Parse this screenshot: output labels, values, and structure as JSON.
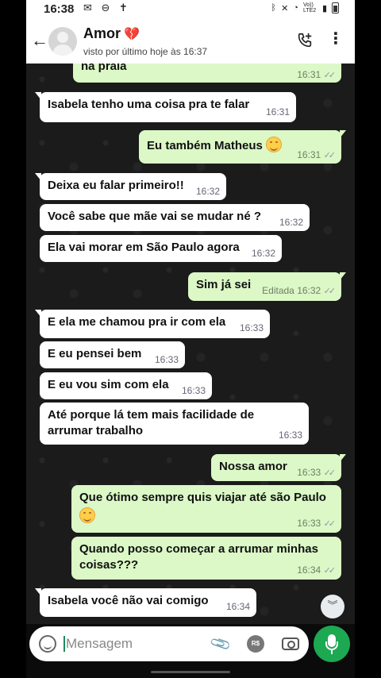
{
  "status_bar": {
    "time": "16:38",
    "left_icons": "✉ ⊖ ✝",
    "network_label": "Vo)) LTE2"
  },
  "header": {
    "contact_name": "Amor",
    "heart_emoji": "💔",
    "last_seen": "visto por último hoje às 16:37",
    "icons": [
      "back-arrow-icon",
      "avatar",
      "add-call-icon",
      "kebab-menu-icon"
    ]
  },
  "messages": [
    {
      "dir": "out",
      "text": "na praia",
      "time": "16:31",
      "ticks": "✓✓"
    },
    {
      "dir": "in",
      "text": "Isabela tenho uma coisa pra te falar",
      "time": "16:31"
    },
    {
      "dir": "out",
      "text": "Eu também Matheus",
      "time": "16:31",
      "ticks": "✓✓",
      "emoji": "smiling-face"
    },
    {
      "dir": "in",
      "text": "Deixa eu falar primeiro!!",
      "time": "16:32"
    },
    {
      "dir": "in",
      "text": "Você sabe que mãe vai se mudar né ?",
      "time": "16:32"
    },
    {
      "dir": "in",
      "text": "Ela vai morar em São Paulo agora",
      "time": "16:32"
    },
    {
      "dir": "out",
      "text": "Sim já sei",
      "time": "Editada 16:32",
      "ticks": "✓✓"
    },
    {
      "dir": "in",
      "text": "E ela me chamou pra ir com ela",
      "time": "16:33"
    },
    {
      "dir": "in",
      "text": "E eu pensei bem",
      "time": "16:33"
    },
    {
      "dir": "in",
      "text": "E eu vou sim com ela",
      "time": "16:33"
    },
    {
      "dir": "in",
      "text": "Até porque lá tem mais facilidade de arrumar trabalho",
      "line1": "Até porque lá tem mais facilidade de",
      "line2": "arrumar trabalho",
      "time": "16:33"
    },
    {
      "dir": "out",
      "text": "Nossa amor",
      "time": "16:33",
      "ticks": "✓✓"
    },
    {
      "dir": "out",
      "text": "Que ótimo sempre quis viajar até são Paulo",
      "time": "16:33",
      "ticks": "✓✓",
      "emoji": "smiling-face"
    },
    {
      "dir": "out",
      "text": "Quando posso começar a arrumar minhas coisas???",
      "line1": "Quando posso começar a arrumar minhas",
      "line2": "coisas???",
      "time": "16:34",
      "ticks": "✓✓"
    },
    {
      "dir": "in",
      "text": "Isabela você não vai comigo",
      "time": "16:34"
    }
  ],
  "scroll_down_icon": "chevron-double-down-icon",
  "composer": {
    "placeholder": "Mensagem",
    "value": "",
    "payment_label": "R$",
    "icons": [
      "emoji-icon",
      "attach-icon",
      "payment-icon",
      "camera-icon",
      "mic-icon"
    ]
  },
  "colors": {
    "incoming_bubble": "#ffffff",
    "outgoing_bubble": "#dbf8c6",
    "chat_background": "#1b1b1b",
    "mic_button": "#1da852"
  }
}
